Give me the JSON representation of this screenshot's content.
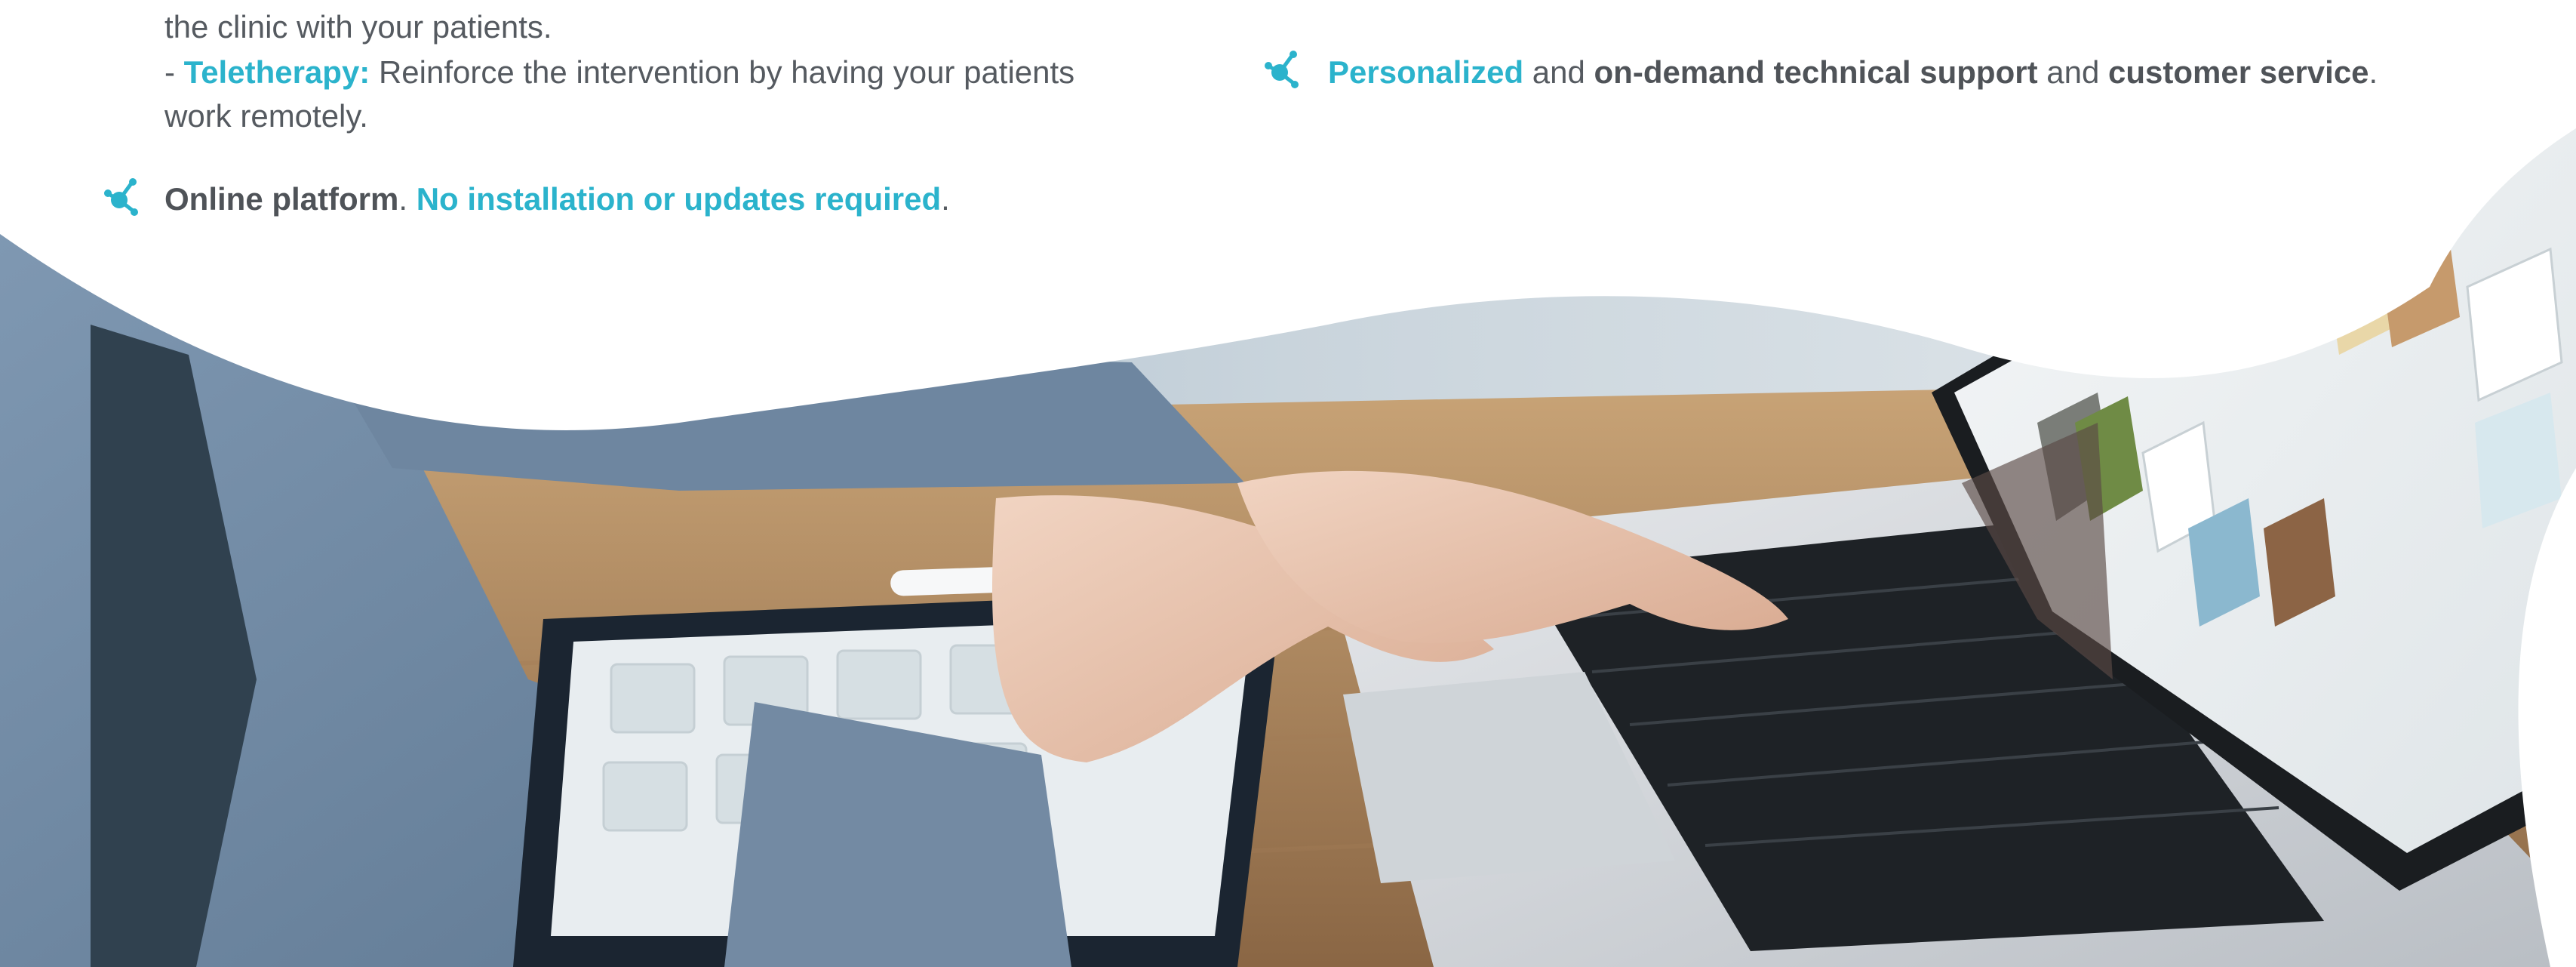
{
  "left_column": {
    "continuation": "the clinic with your patients.",
    "teletherapy": {
      "prefix": "- ",
      "label": "Teletherapy:",
      "text": " Reinforce the intervention by having your patients",
      "wrap": "work remotely."
    },
    "bullet_online": {
      "icon": "molecule-icon",
      "part1": "Online platform",
      "sep": ". ",
      "part2": "No installation or updates required",
      "end": "."
    }
  },
  "right_column": {
    "bullet_support": {
      "icon": "molecule-icon",
      "part1": "Personalized",
      "and1": " and ",
      "part2": "on-demand technical support",
      "and2": " and ",
      "part3": "customer service",
      "end": "."
    }
  },
  "colors": {
    "accent": "#2bb3cc",
    "body_text": "#555a60",
    "bold_text": "#4f5358"
  },
  "photo": {
    "subject": "hands working on a laptop showing a cognitive therapy platform, with a tablet and stylus on a wooden desk"
  }
}
